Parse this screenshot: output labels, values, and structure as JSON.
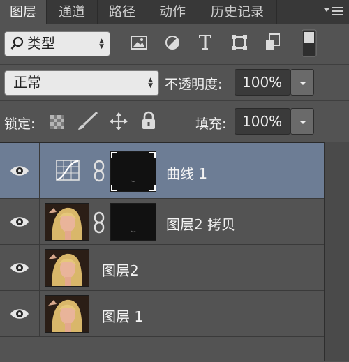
{
  "tabs": [
    {
      "label": "图层",
      "active": true
    },
    {
      "label": "通道",
      "active": false
    },
    {
      "label": "路径",
      "active": false
    },
    {
      "label": "动作",
      "active": false
    },
    {
      "label": "历史记录",
      "active": false
    }
  ],
  "panel_menu_icon": "panel-menu-icon",
  "filter": {
    "kind_label": "类型",
    "icons": [
      "image-filter-icon",
      "adjustment-filter-icon",
      "type-filter-icon",
      "shape-filter-icon",
      "smart-object-filter-icon",
      "filter-toggle-icon"
    ]
  },
  "blend": {
    "mode": "正常",
    "opacity_label": "不透明度:",
    "opacity_value": "100%"
  },
  "lock": {
    "label": "锁定:",
    "icons": [
      "lock-transparent-pixels-icon",
      "lock-image-pixels-icon",
      "lock-position-icon",
      "lock-all-icon"
    ],
    "fill_label": "填充:",
    "fill_value": "100%"
  },
  "layers": [
    {
      "name": "曲线 1",
      "type": "adjustment-curves",
      "visible": true,
      "selected": true
    },
    {
      "name": "图层2 拷贝",
      "type": "image-with-mask",
      "visible": true,
      "selected": false
    },
    {
      "name": "图层2",
      "type": "image",
      "visible": true,
      "selected": false
    },
    {
      "name": "图层 1",
      "type": "image",
      "visible": true,
      "selected": false
    }
  ],
  "colors": {
    "panel_bg": "#535353",
    "tabbar_bg": "#383838",
    "selected_layer": "#6d7d95"
  }
}
